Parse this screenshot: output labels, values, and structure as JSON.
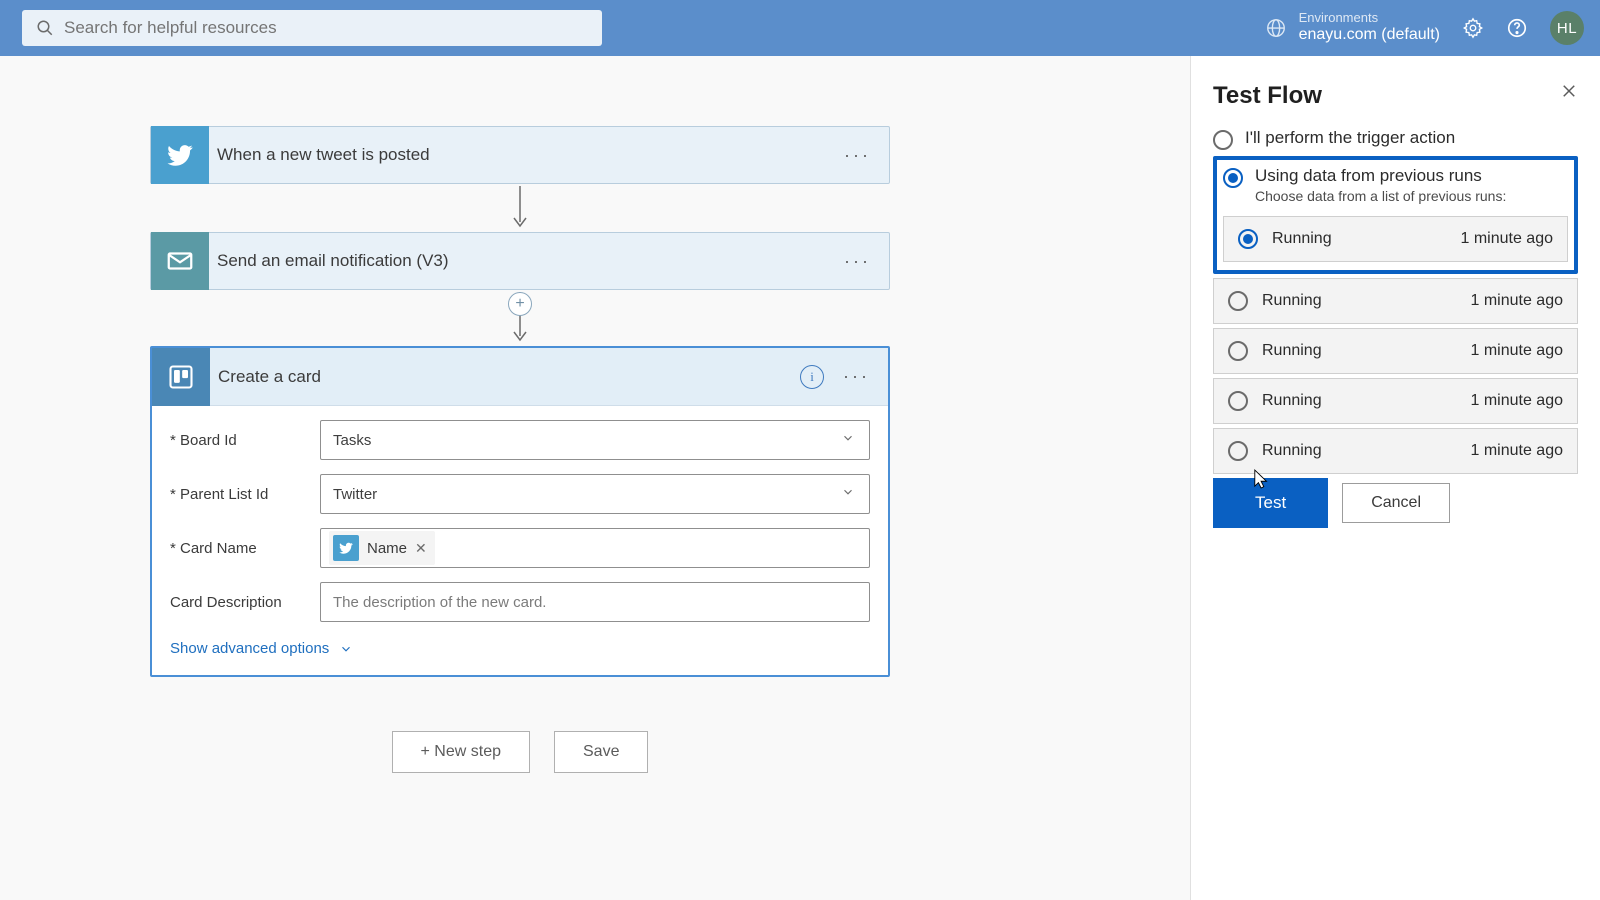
{
  "header": {
    "search_placeholder": "Search for helpful resources",
    "env_label": "Environments",
    "env_value": "enayu.com (default)",
    "avatar_initials": "HL"
  },
  "flow": {
    "steps": [
      {
        "title": "When a new tweet is posted",
        "icon": "twitter"
      },
      {
        "title": "Send an email notification (V3)",
        "icon": "mail"
      }
    ],
    "expanded": {
      "title": "Create a card",
      "fields": {
        "board": {
          "label": "* Board Id",
          "value": "Tasks"
        },
        "list": {
          "label": "* Parent List Id",
          "value": "Twitter"
        },
        "cardname": {
          "label": "* Card Name",
          "token": "Name"
        },
        "desc": {
          "label": "Card Description",
          "placeholder": "The description of the new card."
        }
      },
      "advanced": "Show advanced options"
    },
    "buttons": {
      "new_step": "+ New step",
      "save": "Save"
    }
  },
  "panel": {
    "title": "Test Flow",
    "options": {
      "manual": "I'll perform the trigger action",
      "previous": "Using data from previous runs",
      "previous_sub": "Choose data from a list of previous runs:"
    },
    "runs": [
      {
        "status": "Running",
        "time": "1 minute ago",
        "selected": true
      },
      {
        "status": "Running",
        "time": "1 minute ago",
        "selected": false
      },
      {
        "status": "Running",
        "time": "1 minute ago",
        "selected": false
      },
      {
        "status": "Running",
        "time": "1 minute ago",
        "selected": false
      },
      {
        "status": "Running",
        "time": "1 minute ago",
        "selected": false
      }
    ],
    "buttons": {
      "test": "Test",
      "cancel": "Cancel"
    }
  }
}
